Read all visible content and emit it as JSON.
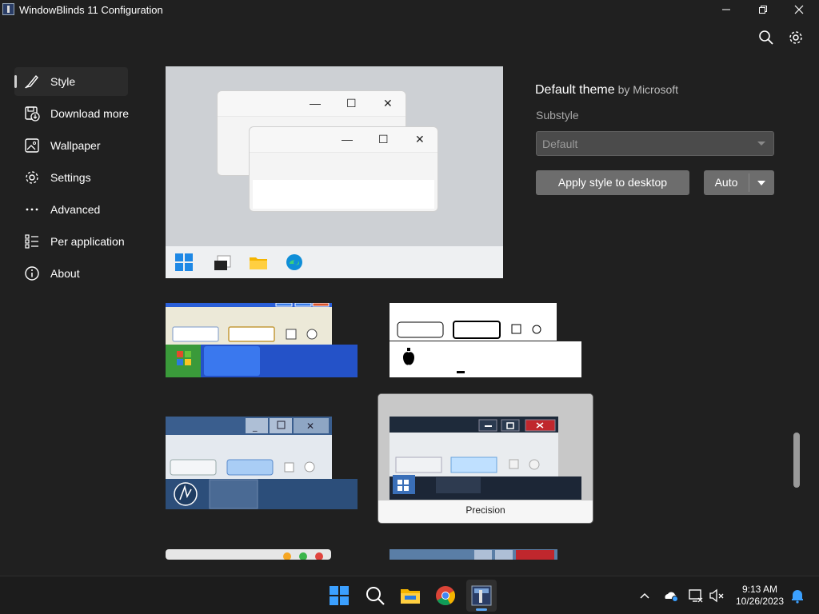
{
  "window": {
    "title": "WindowBlinds 11 Configuration",
    "minimize_icon": "minimize-icon",
    "maximize_icon": "maximize-icon",
    "close_icon": "close-icon"
  },
  "toolbar": {
    "search_icon": "search-icon",
    "settings_icon": "gear-icon"
  },
  "sidebar": {
    "items": [
      {
        "label": "Style",
        "icon": "brush-icon",
        "active": true
      },
      {
        "label": "Download more styles",
        "icon": "download-icon"
      },
      {
        "label": "Wallpaper",
        "icon": "image-icon"
      },
      {
        "label": "Settings",
        "icon": "gear-icon"
      },
      {
        "label": "Advanced",
        "icon": "more-dots-icon"
      },
      {
        "label": "Per application",
        "icon": "list-icon"
      },
      {
        "label": "About",
        "icon": "info-icon"
      }
    ]
  },
  "theme": {
    "name": "Default theme",
    "author": "by Microsoft",
    "substyle_label": "Substyle",
    "substyle_value": "Default",
    "apply_label": "Apply style to desktop",
    "auto_label": "Auto"
  },
  "gallery": {
    "selected_caption": "Precision"
  },
  "taskbar": {
    "time": "9:13 AM",
    "date": "10/26/2023"
  },
  "colors": {
    "background": "#202020",
    "button": "#6d6d6d"
  }
}
